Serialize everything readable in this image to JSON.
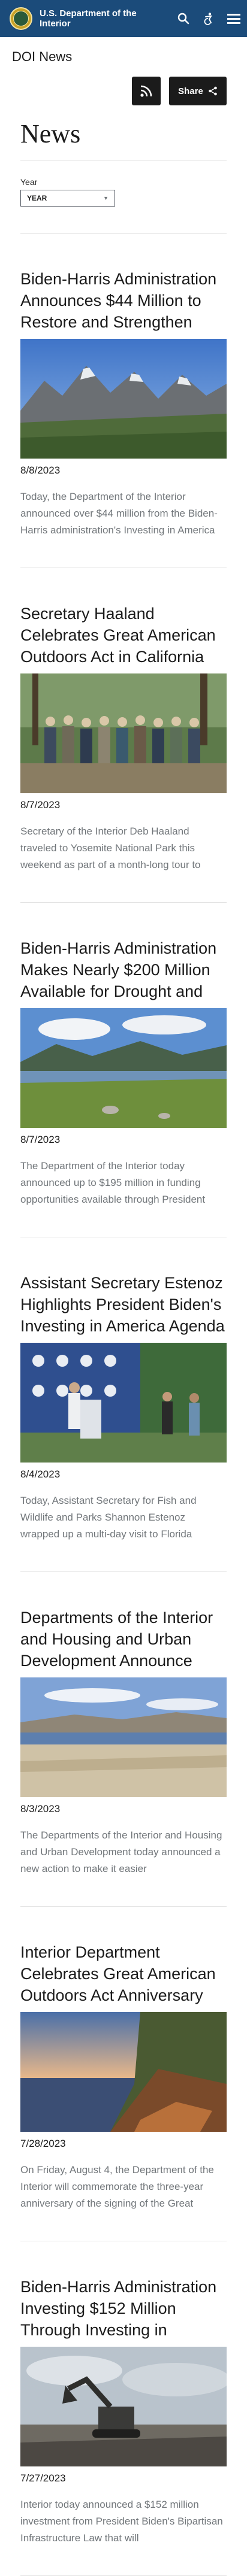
{
  "header": {
    "title": "U.S. Department of the Interior",
    "icons": [
      "search-icon",
      "accessibility-icon",
      "menu-icon"
    ]
  },
  "section": {
    "label": "DOI News"
  },
  "toolbar": {
    "share_label": "Share"
  },
  "page": {
    "title": "News"
  },
  "filter": {
    "label": "Year",
    "selected": "YEAR"
  },
  "articles": [
    {
      "title": "Biden-Harris Administration Announces $44 Million to Restore and Strengthen Climate Resilience",
      "date": "8/8/2023",
      "summary": "Today, the Department of the Interior announced over $44 million from the Biden-Harris administration's Investing in America agenda"
    },
    {
      "title": "Secretary Haaland Celebrates Great American Outdoors Act in California",
      "date": "8/7/2023",
      "summary": "Secretary of the Interior Deb Haaland traveled to Yosemite National Park this weekend as part of a month-long tour to celebrate"
    },
    {
      "title": "Biden-Harris Administration Makes Nearly $200 Million Available for Drought and Ecosystem Resilience",
      "date": "8/7/2023",
      "summary": "The Department of the Interior today announced up to $195 million in funding opportunities available through President Biden's"
    },
    {
      "title": "Assistant Secretary Estenoz Highlights President Biden's Investing in America Agenda in Florida",
      "date": "8/4/2023",
      "summary": "Today, Assistant Secretary for Fish and Wildlife and Parks Shannon Estenoz wrapped up a multi-day visit to Florida"
    },
    {
      "title": "Departments of the Interior and Housing and Urban Development Announce Action to Make it Easier",
      "date": "8/3/2023",
      "summary": "The Departments of the Interior and Housing and Urban Development today announced a new action to make it easier"
    },
    {
      "title": "Interior Department Celebrates Great American Outdoors Act Anniversary with Fee-Free Day",
      "date": "7/28/2023",
      "summary": "On Friday, August 4, the Department of the Interior will commemorate the three-year anniversary of the signing of the Great American Outdoors Act"
    },
    {
      "title": "Biden-Harris Administration Investing $152 Million Through Investing in America Agenda to Strengthen",
      "date": "7/27/2023",
      "summary": "Interior today announced a $152 million investment from President Biden's Bipartisan Infrastructure Law that will"
    }
  ],
  "colors": {
    "header_bg": "#1b4b7a",
    "button_bg": "#1b1b1b",
    "summary_text": "#71767a"
  }
}
